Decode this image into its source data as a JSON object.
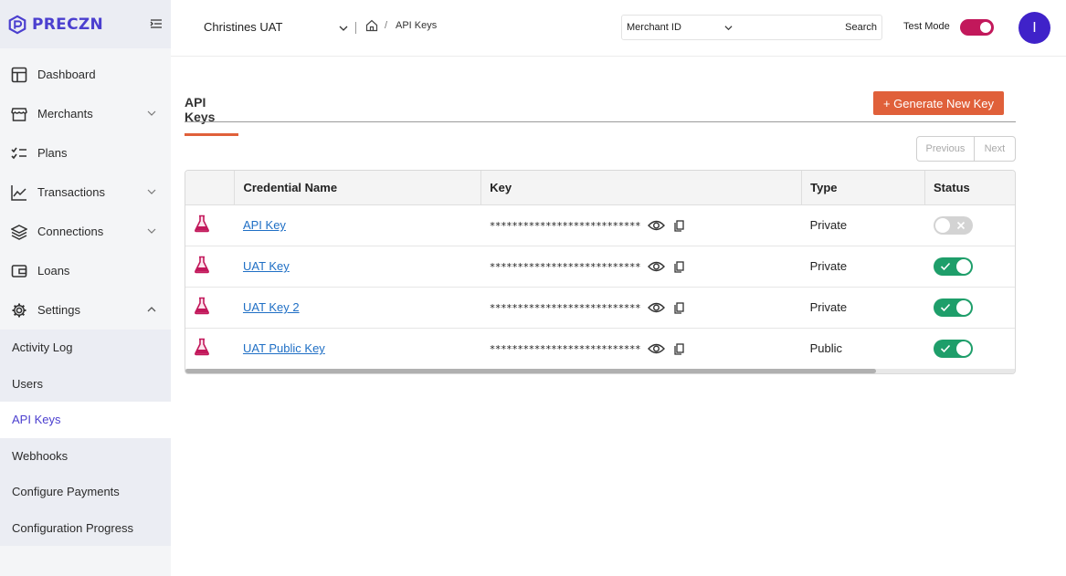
{
  "brand": {
    "name": "PRECZN",
    "color": "#4b3fcf"
  },
  "sidebar": {
    "items": [
      {
        "label": "Dashboard",
        "icon": "dashboard-icon",
        "expandable": false
      },
      {
        "label": "Merchants",
        "icon": "store-icon",
        "expandable": true
      },
      {
        "label": "Plans",
        "icon": "checklist-icon",
        "expandable": false
      },
      {
        "label": "Transactions",
        "icon": "chart-line-icon",
        "expandable": true
      },
      {
        "label": "Connections",
        "icon": "layers-icon",
        "expandable": true
      },
      {
        "label": "Loans",
        "icon": "wallet-icon",
        "expandable": false
      },
      {
        "label": "Settings",
        "icon": "gear-icon",
        "expanded": true
      }
    ],
    "settings_sub": [
      {
        "label": "Activity Log",
        "active": false
      },
      {
        "label": "Users",
        "active": false
      },
      {
        "label": "API Keys",
        "active": true
      },
      {
        "label": "Webhooks",
        "active": false
      },
      {
        "label": "Configure Payments",
        "active": false
      },
      {
        "label": "Configuration Progress",
        "active": false
      }
    ]
  },
  "header": {
    "account": "Christines UAT",
    "breadcrumb_current": "API Keys",
    "search_field": "Merchant ID",
    "search_value": "",
    "search_label": "Search",
    "test_mode_label": "Test Mode",
    "test_mode_on": true,
    "avatar_initial": "I"
  },
  "page": {
    "tab_label": "API Keys",
    "generate_label": "+ Generate New Key",
    "accent_color": "#e0603a",
    "pager": {
      "prev": "Previous",
      "next": "Next"
    }
  },
  "table": {
    "columns": [
      "",
      "Credential Name",
      "Key",
      "Type",
      "Status"
    ],
    "rows": [
      {
        "name": "API Key",
        "key": "***************************",
        "type": "Private",
        "status_on": false
      },
      {
        "name": "UAT Key",
        "key": "***************************",
        "type": "Private",
        "status_on": true
      },
      {
        "name": "UAT Key 2",
        "key": "***************************",
        "type": "Private",
        "status_on": true
      },
      {
        "name": "UAT Public Key",
        "key": "***************************",
        "type": "Public",
        "status_on": true
      }
    ]
  }
}
